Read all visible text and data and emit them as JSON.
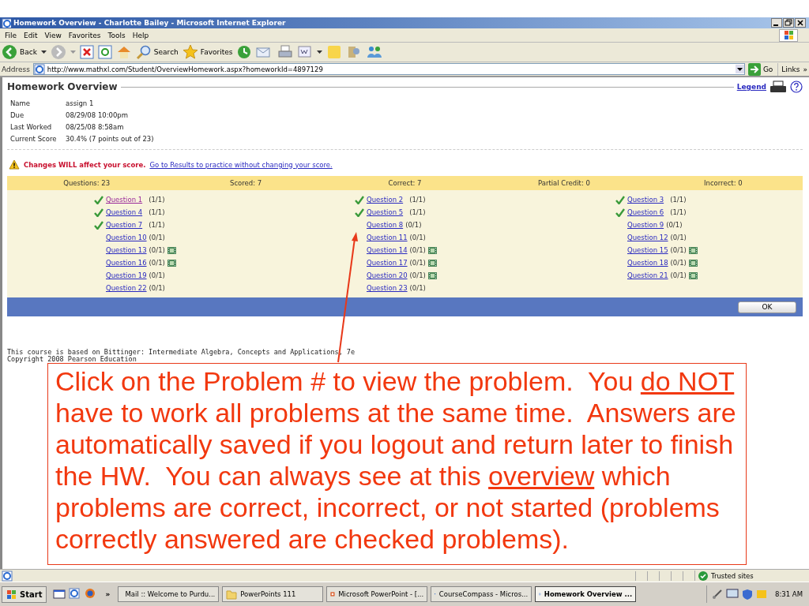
{
  "window": {
    "title": "Homework Overview - Charlotte Bailey - Microsoft Internet Explorer"
  },
  "menu": [
    "File",
    "Edit",
    "View",
    "Favorites",
    "Tools",
    "Help"
  ],
  "toolbar": {
    "back": "Back",
    "search": "Search",
    "favorites": "Favorites"
  },
  "address": {
    "label": "Address",
    "url": "http://www.mathxl.com/Student/OverviewHomework.aspx?homeworkId=4897129",
    "go": "Go",
    "links": "Links",
    "chevron": "»"
  },
  "page": {
    "heading": "Homework Overview",
    "legend": "Legend",
    "details": [
      {
        "label": "Name",
        "value": "assign 1"
      },
      {
        "label": "Due",
        "value": "08/29/08 10:00pm"
      },
      {
        "label": "Last Worked",
        "value": "08/25/08 8:58am"
      },
      {
        "label": "Current Score",
        "value": "30.4% (7 points out of 23)"
      }
    ],
    "warning": {
      "text": "Changes WILL affect your score.",
      "link": "Go to Results to practice without changing your score."
    },
    "summary": [
      "Questions: 23",
      "Scored: 7",
      "Correct: 7",
      "Partial Credit: 0",
      "Incorrect: 0"
    ],
    "questions": [
      {
        "label": "Question 1",
        "score": "(1/1)",
        "correct": true,
        "visited": true,
        "media": false
      },
      {
        "label": "Question 2",
        "score": "(1/1)",
        "correct": true,
        "visited": false,
        "media": false
      },
      {
        "label": "Question 3",
        "score": "(1/1)",
        "correct": true,
        "visited": false,
        "media": false
      },
      {
        "label": "Question 4",
        "score": "(1/1)",
        "correct": true,
        "visited": false,
        "media": false
      },
      {
        "label": "Question 5",
        "score": "(1/1)",
        "correct": true,
        "visited": false,
        "media": false
      },
      {
        "label": "Question 6",
        "score": "(1/1)",
        "correct": true,
        "visited": false,
        "media": false
      },
      {
        "label": "Question 7",
        "score": "(1/1)",
        "correct": true,
        "visited": false,
        "media": false
      },
      {
        "label": "Question 8",
        "score": "(0/1)",
        "correct": false,
        "visited": false,
        "media": false
      },
      {
        "label": "Question 9",
        "score": "(0/1)",
        "correct": false,
        "visited": false,
        "media": false
      },
      {
        "label": "Question 10",
        "score": "(0/1)",
        "correct": false,
        "visited": false,
        "media": false
      },
      {
        "label": "Question 11",
        "score": "(0/1)",
        "correct": false,
        "visited": false,
        "media": false
      },
      {
        "label": "Question 12",
        "score": "(0/1)",
        "correct": false,
        "visited": false,
        "media": false
      },
      {
        "label": "Question 13",
        "score": "(0/1)",
        "correct": false,
        "visited": false,
        "media": true
      },
      {
        "label": "Question 14",
        "score": "(0/1)",
        "correct": false,
        "visited": false,
        "media": true
      },
      {
        "label": "Question 15",
        "score": "(0/1)",
        "correct": false,
        "visited": false,
        "media": true
      },
      {
        "label": "Question 16",
        "score": "(0/1)",
        "correct": false,
        "visited": false,
        "media": true
      },
      {
        "label": "Question 17",
        "score": "(0/1)",
        "correct": false,
        "visited": false,
        "media": true
      },
      {
        "label": "Question 18",
        "score": "(0/1)",
        "correct": false,
        "visited": false,
        "media": true
      },
      {
        "label": "Question 19",
        "score": "(0/1)",
        "correct": false,
        "visited": false,
        "media": false
      },
      {
        "label": "Question 20",
        "score": "(0/1)",
        "correct": false,
        "visited": false,
        "media": true
      },
      {
        "label": "Question 21",
        "score": "(0/1)",
        "correct": false,
        "visited": false,
        "media": true
      },
      {
        "label": "Question 22",
        "score": "(0/1)",
        "correct": false,
        "visited": false,
        "media": false
      },
      {
        "label": "Question 23",
        "score": "(0/1)",
        "correct": false,
        "visited": false,
        "media": false
      }
    ],
    "ok": "OK",
    "footer": [
      "This course is based on Bittinger: Intermediate Algebra, Concepts and Applications, 7e",
      "Copyright 2008 Pearson Education"
    ]
  },
  "callout": {
    "segments": [
      {
        "text": "Click on the Problem # to view the problem.  You ",
        "underlined": false
      },
      {
        "text": "do NOT",
        "underlined": true
      },
      {
        "text": " have to work all problems at the same time.  Answers are automatically saved if you logout and return later to finish the HW.  You can always see at this ",
        "underlined": false
      },
      {
        "text": "overview",
        "underlined": true
      },
      {
        "text": " which problems are correct, incorrect, or not started (problems correctly answered are checked problems).",
        "underlined": false
      }
    ]
  },
  "status": {
    "zone": "Trusted sites"
  },
  "taskbar": {
    "start": "Start",
    "chevron": "»",
    "tasks": [
      {
        "label": "Mail :: Welcome to Purdu...",
        "selected": false
      },
      {
        "label": "PowerPoints 111",
        "selected": false
      },
      {
        "label": "Microsoft PowerPoint - [...",
        "selected": false
      },
      {
        "label": "CourseCompass - Micros...",
        "selected": false
      },
      {
        "label": "Homework Overview ...",
        "selected": true
      }
    ],
    "clock": "8:31 AM"
  }
}
